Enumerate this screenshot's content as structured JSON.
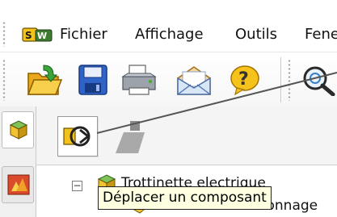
{
  "menubar": {
    "items": [
      {
        "label": "Fichier",
        "icon": "solidworks-logo-icon"
      },
      {
        "label": "Affichage"
      },
      {
        "label": "Outils"
      },
      {
        "label": "Fene"
      }
    ]
  },
  "toolbar": {
    "buttons": [
      {
        "name": "open-file-button",
        "icon": "open-folder-icon"
      },
      {
        "name": "save-button",
        "icon": "floppy-disk-icon"
      },
      {
        "name": "print-button",
        "icon": "printer-icon"
      },
      {
        "name": "email-button",
        "icon": "envelope-icon"
      },
      {
        "name": "help-button",
        "icon": "help-icon"
      },
      {
        "name": "zoom-button",
        "icon": "magnifier-icon"
      }
    ]
  },
  "side_tabs": [
    {
      "name": "feature-manager-tab",
      "icon": "feature-tree-icon",
      "active": true
    },
    {
      "name": "property-manager-tab",
      "icon": "assembly-icon",
      "active": false
    }
  ],
  "panel": {
    "tools": [
      {
        "name": "move-component-button",
        "icon": "move-component-icon",
        "pressed": true
      },
      {
        "name": "rotate-component-button",
        "icon": "component-gray-icon",
        "pressed": false
      }
    ],
    "tree": [
      {
        "label": "Trottinette electrique",
        "expander": "−"
      },
      {
        "label": "Chronee de versionnage"
      }
    ]
  },
  "tooltip": {
    "text": "Déplacer un composant"
  }
}
